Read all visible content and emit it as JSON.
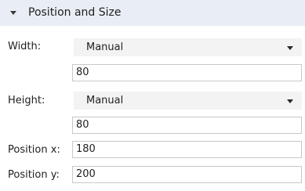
{
  "section": {
    "title": "Position and Size",
    "expanded_icon": "triangle-down-icon"
  },
  "width": {
    "label": "Width:",
    "mode": "Manual",
    "value": "80"
  },
  "height": {
    "label": "Height:",
    "mode": "Manual",
    "value": "80"
  },
  "position_x": {
    "label": "Position x:",
    "value": "180"
  },
  "position_y": {
    "label": "Position y:",
    "value": "200"
  },
  "colors": {
    "header_background": "#e9eef6",
    "dropdown_background": "#f3f3f3",
    "input_border": "#c8c8c8"
  }
}
